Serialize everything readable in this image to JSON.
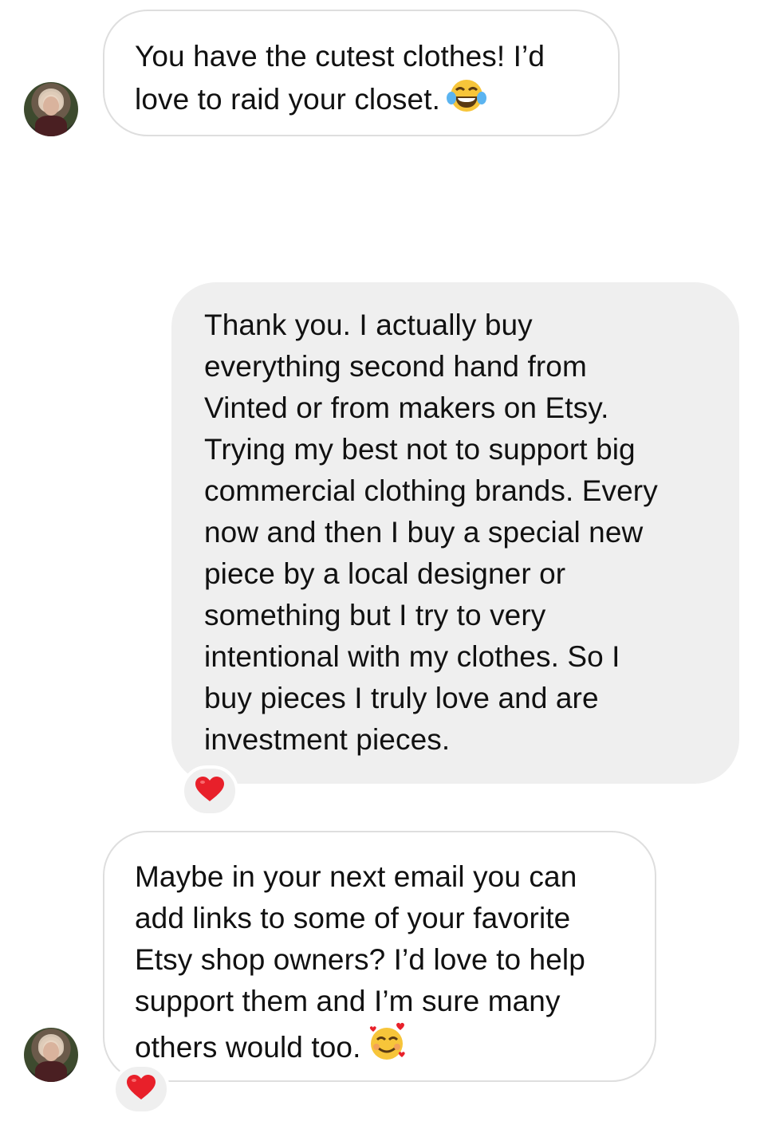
{
  "messages": [
    {
      "direction": "received",
      "text": "You have the cutest clothes! I’d\nlove to raid your closet.",
      "emoji": "face-with-tears-of-joy-icon"
    },
    {
      "direction": "sent",
      "text": "Thank you. I actually buy\neverything second hand from\nVinted or from makers on Etsy.\nTrying my best not to support big\ncommercial clothing brands. Every\nnow and then I buy a special new\npiece by a local designer or\nsomething but I try to very\nintentional with my clothes. So I\nbuy pieces I truly love and are\ninvestment pieces.",
      "reaction": "red-heart-icon"
    },
    {
      "direction": "received",
      "text": "Maybe in your next email you can\nadd links to some of your favorite\nEtsy shop owners? I’d love to help\nsupport them and I’m sure many\nothers would too.",
      "emoji": "smiling-face-with-hearts-icon",
      "reaction": "red-heart-icon"
    }
  ],
  "colors": {
    "received_border": "#dedede",
    "sent_background": "#efefef",
    "heart": "#e8202a",
    "emoji_yellow": "#f7c53a"
  }
}
